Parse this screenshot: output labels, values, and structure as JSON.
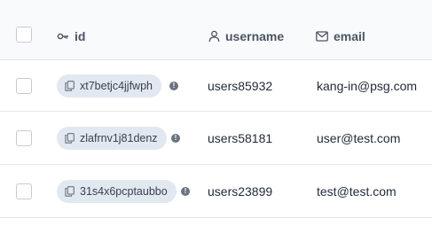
{
  "header": {
    "id_label": "id",
    "username_label": "username",
    "email_label": "email",
    "id_icon": "key-icon",
    "username_icon": "user-icon",
    "email_icon": "mail-icon"
  },
  "rows": [
    {
      "id": "xt7betjc4jjfwph",
      "username": "users85932",
      "email": "kang-in@psg.com"
    },
    {
      "id": "zlafrnv1j81denz",
      "username": "users58181",
      "email": "user@test.com"
    },
    {
      "id": "31s4x6pcptaubbo",
      "username": "users23899",
      "email": "test@test.com"
    }
  ],
  "info_glyph": "!"
}
